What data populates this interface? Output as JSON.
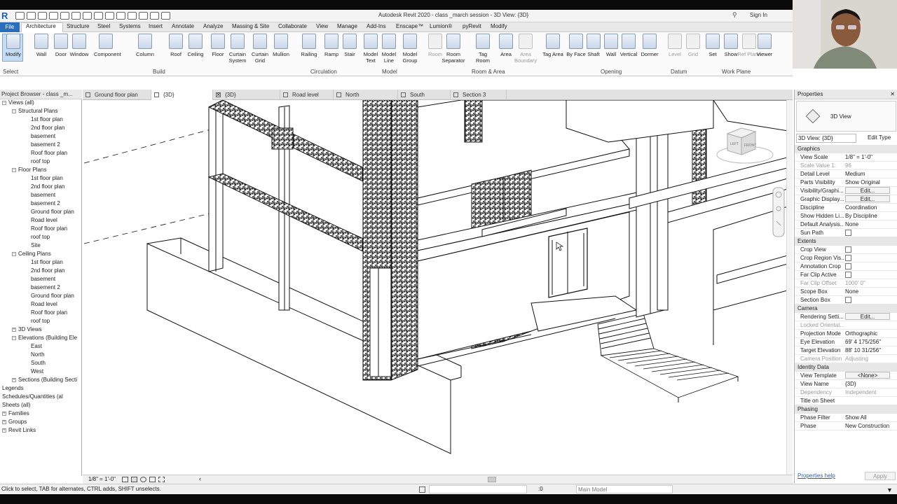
{
  "app": {
    "title": "Autodesk Revit 2020 - class _march session - 3D View: {3D}",
    "logo": "R",
    "signin": "Sign In",
    "qat_icons": [
      "open-icon",
      "save-icon",
      "sync-icon",
      "undo-icon",
      "redo-icon",
      "print-icon",
      "measure-icon",
      "dimension-icon",
      "text-icon",
      "3d-icon",
      "section-icon",
      "thin-lines-icon",
      "close-hidden-icon",
      "switch-windows-icon"
    ]
  },
  "ribbon": {
    "tabs": [
      "File",
      "Architecture",
      "Structure",
      "Steel",
      "Systems",
      "Insert",
      "Annotate",
      "Analyze",
      "Massing & Site",
      "Collaborate",
      "View",
      "Manage",
      "Add-Ins",
      "Enscape™",
      "Lumion®",
      "pyRevit",
      "Modify"
    ],
    "active_tab": "Architecture",
    "tools": [
      {
        "label": "Modify",
        "icon": "modify-icon"
      },
      {
        "label": "Wall",
        "icon": "wall-icon"
      },
      {
        "label": "Door",
        "icon": "door-icon"
      },
      {
        "label": "Window",
        "icon": "window-icon"
      },
      {
        "label": "Component",
        "icon": "component-icon"
      },
      {
        "label": "Column",
        "icon": "column-icon"
      },
      {
        "label": "Roof",
        "icon": "roof-icon"
      },
      {
        "label": "Ceiling",
        "icon": "ceiling-icon"
      },
      {
        "label": "Floor",
        "icon": "floor-icon"
      },
      {
        "label": "Curtain System",
        "icon": "curtain-system-icon"
      },
      {
        "label": "Curtain Grid",
        "icon": "curtain-grid-icon"
      },
      {
        "label": "Mullion",
        "icon": "mullion-icon"
      },
      {
        "label": "Railing",
        "icon": "railing-icon"
      },
      {
        "label": "Ramp",
        "icon": "ramp-icon"
      },
      {
        "label": "Stair",
        "icon": "stair-icon"
      },
      {
        "label": "Model Text",
        "icon": "model-text-icon"
      },
      {
        "label": "Model Line",
        "icon": "model-line-icon"
      },
      {
        "label": "Model Group",
        "icon": "model-group-icon"
      },
      {
        "label": "Room",
        "icon": "room-icon",
        "disabled": true
      },
      {
        "label": "Room Separator",
        "icon": "room-separator-icon"
      },
      {
        "label": "Tag Room",
        "icon": "tag-room-icon"
      },
      {
        "label": "Area",
        "icon": "area-icon"
      },
      {
        "label": "Area Boundary",
        "icon": "area-boundary-icon",
        "disabled": true
      },
      {
        "label": "Tag Area",
        "icon": "tag-area-icon"
      },
      {
        "label": "By Face",
        "icon": "by-face-icon"
      },
      {
        "label": "Shaft",
        "icon": "shaft-icon"
      },
      {
        "label": "Wall",
        "icon": "wall-opening-icon"
      },
      {
        "label": "Vertical",
        "icon": "vertical-icon"
      },
      {
        "label": "Dormer",
        "icon": "dormer-icon"
      },
      {
        "label": "Level",
        "icon": "level-icon",
        "disabled": true
      },
      {
        "label": "Grid",
        "icon": "grid-icon",
        "disabled": true
      },
      {
        "label": "Set",
        "icon": "set-icon"
      },
      {
        "label": "Show",
        "icon": "show-icon"
      },
      {
        "label": "Ref Plane",
        "icon": "ref-plane-icon",
        "disabled": true
      },
      {
        "label": "Viewer",
        "icon": "viewer-icon"
      }
    ],
    "panels": {
      "select": "Select",
      "build": "Build",
      "circulation": "Circulation",
      "model": "Model",
      "room_area": "Room & Area",
      "opening": "Opening",
      "datum": "Datum",
      "work_plane": "Work Plane"
    }
  },
  "view_tabs": [
    {
      "label": "Ground floor plan",
      "active": false
    },
    {
      "label": "{3D}",
      "active": true
    },
    {
      "label": "{3D}",
      "active": false
    },
    {
      "label": "Road level",
      "active": false
    },
    {
      "label": "North",
      "active": false
    },
    {
      "label": "South",
      "active": false
    },
    {
      "label": "Section 3",
      "active": false
    }
  ],
  "project_browser": {
    "title": "Project Browser - class _m...",
    "root": "Views (all)",
    "groups": [
      {
        "label": "Structural Plans",
        "items": [
          "1st floor plan",
          "2nd floor plan",
          "basement",
          "basement 2",
          "Roof floor plan",
          "roof top"
        ]
      },
      {
        "label": "Floor Plans",
        "items": [
          "1st floor plan",
          "2nd floor plan",
          "basement",
          "basement 2",
          "Ground floor plan",
          "Road level",
          "Roof floor plan",
          "roof top",
          "Site"
        ]
      },
      {
        "label": "Ceiling Plans",
        "items": [
          "1st floor plan",
          "2nd floor plan",
          "basement",
          "basement 2",
          "Ground floor plan",
          "Road level",
          "Roof floor plan",
          "roof top"
        ]
      },
      {
        "label": "3D Views",
        "items": []
      },
      {
        "label": "Elevations (Building Ele",
        "items": [
          "East",
          "North",
          "South",
          "West"
        ]
      },
      {
        "label": "Sections (Building Secti",
        "items": []
      }
    ],
    "other": [
      "Legends",
      "Schedules/Quantities (al",
      "Sheets (all)",
      "Families",
      "Groups",
      "Revit Links"
    ]
  },
  "view_cube": {
    "left": "LEFT",
    "front": "FRONT"
  },
  "view_control_bar": {
    "scale": "1/8\" = 1'-0\""
  },
  "status_bar": {
    "hint": "Click to select, TAB for alternates, CTRL adds, SHIFT unselects.",
    "zero": ":0",
    "model": "Main Model"
  },
  "properties": {
    "title": "Properties",
    "type_name": "3D View",
    "selector": "3D View: {3D}",
    "edit_type": "Edit Type",
    "sections": [
      {
        "name": "Graphics",
        "rows": [
          {
            "label": "View Scale",
            "value": "1/8\" = 1'-0\""
          },
          {
            "label": "Scale Value   1:",
            "value": "96",
            "dim": true
          },
          {
            "label": "Detail Level",
            "value": "Medium"
          },
          {
            "label": "Parts Visibility",
            "value": "Show Original"
          },
          {
            "label": "Visibility/Graphi...",
            "value": "Edit...",
            "button": true
          },
          {
            "label": "Graphic Display...",
            "value": "Edit...",
            "button": true
          },
          {
            "label": "Discipline",
            "value": "Coordination"
          },
          {
            "label": "Show Hidden Li...",
            "value": "By Discipline"
          },
          {
            "label": "Default Analysis...",
            "value": "None"
          },
          {
            "label": "Sun Path",
            "value": "",
            "checkbox": true
          }
        ]
      },
      {
        "name": "Extents",
        "rows": [
          {
            "label": "Crop View",
            "value": "",
            "checkbox": true
          },
          {
            "label": "Crop Region Vis...",
            "value": "",
            "checkbox": true
          },
          {
            "label": "Annotation Crop",
            "value": "",
            "checkbox": true
          },
          {
            "label": "Far Clip Active",
            "value": "",
            "checkbox": true
          },
          {
            "label": "Far Clip Offset",
            "value": "1000'  0\"",
            "dim": true
          },
          {
            "label": "Scope Box",
            "value": "None"
          },
          {
            "label": "Section Box",
            "value": "",
            "checkbox": true
          }
        ]
      },
      {
        "name": "Camera",
        "rows": [
          {
            "label": "Rendering Setti...",
            "value": "Edit...",
            "button": true
          },
          {
            "label": "Locked Orientat...",
            "value": "",
            "dim": true
          },
          {
            "label": "Projection Mode",
            "value": "Orthographic"
          },
          {
            "label": "Eye Elevation",
            "value": "69'  4 175/256\""
          },
          {
            "label": "Target Elevation",
            "value": "88'  10 31/256\""
          },
          {
            "label": "Camera Position",
            "value": "Adjusting",
            "dim": true
          }
        ]
      },
      {
        "name": "Identity Data",
        "rows": [
          {
            "label": "View Template",
            "value": "<None>",
            "button": true
          },
          {
            "label": "View Name",
            "value": "{3D}"
          },
          {
            "label": "Dependency",
            "value": "Independent",
            "dim": true
          },
          {
            "label": "Title on Sheet",
            "value": ""
          }
        ]
      },
      {
        "name": "Phasing",
        "rows": [
          {
            "label": "Phase Filter",
            "value": "Show All"
          },
          {
            "label": "Phase",
            "value": "New Construction"
          }
        ]
      }
    ],
    "help": "Properties help",
    "apply": "Apply"
  }
}
